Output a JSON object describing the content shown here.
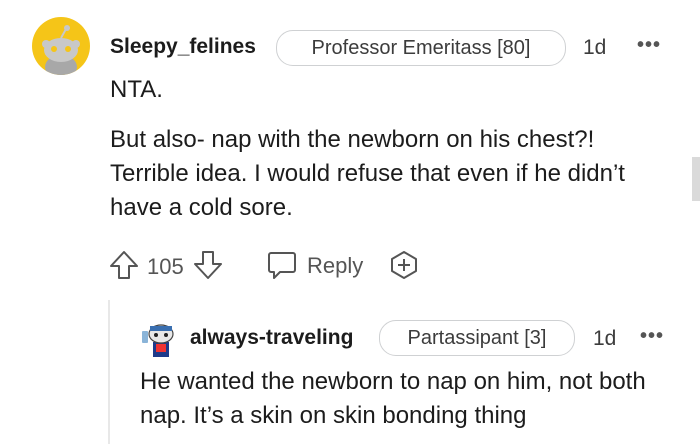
{
  "comment": {
    "username": "Sleepy_felines",
    "flair": "Professor Emeritass [80]",
    "age": "1d",
    "more": "•••",
    "paragraphs": [
      "NTA.",
      "But also- nap with the newborn on his chest?! Terrible idea. I would refuse that even if he didn’t have a cold sore."
    ],
    "votes": "105",
    "reply_label": "Reply"
  },
  "reply": {
    "username": "always-traveling",
    "flair": "Partassipant [3]",
    "age": "1d",
    "more": "•••",
    "text": "He wanted the newborn to nap on him, not both nap. It’s a skin on skin bonding thing"
  },
  "colors": {
    "avatar_bg": "#f5c518",
    "text": "#1c1c1c",
    "muted": "#555555",
    "flair_border": "#cfd1d3"
  },
  "icons": [
    "snoo-avatar",
    "upvote-icon",
    "downvote-icon",
    "reply-icon",
    "award-icon",
    "more-icon"
  ]
}
